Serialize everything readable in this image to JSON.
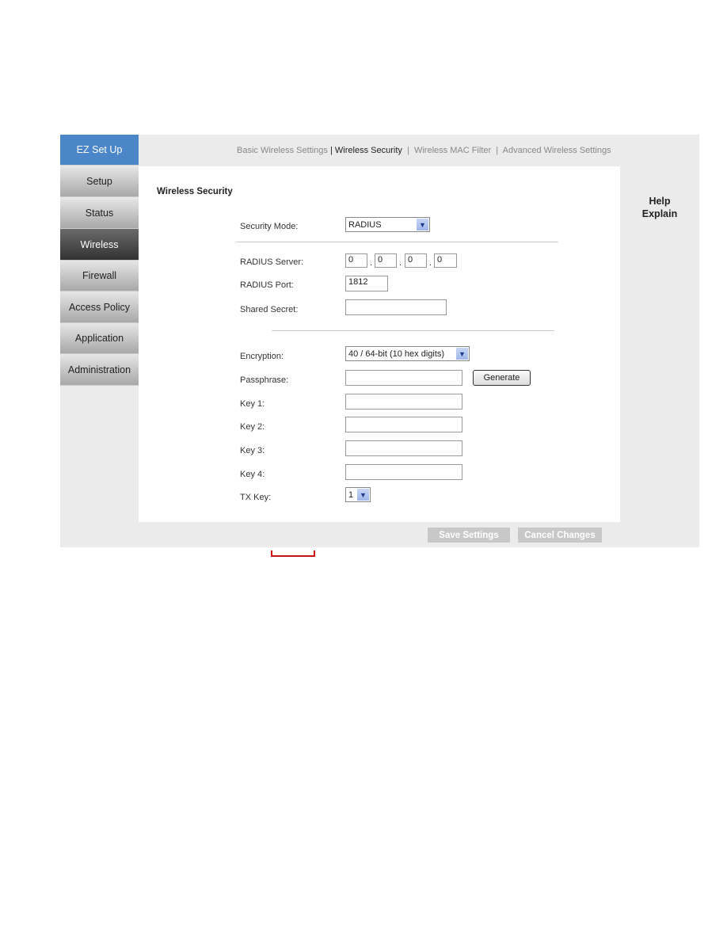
{
  "sidebar": {
    "items": [
      {
        "label": "EZ Set Up"
      },
      {
        "label": "Setup"
      },
      {
        "label": "Status"
      },
      {
        "label": "Wireless"
      },
      {
        "label": "Firewall"
      },
      {
        "label": "Access Policy"
      },
      {
        "label": "Application"
      },
      {
        "label": "Administration"
      }
    ]
  },
  "tabs": [
    {
      "label": "Basic Wireless Settings"
    },
    {
      "label": "Wireless Security"
    },
    {
      "label": "Wireless MAC Filter"
    },
    {
      "label": "Advanced Wireless Settings"
    }
  ],
  "section_title": "Wireless Security",
  "help": {
    "line1": "Help",
    "line2": "Explain"
  },
  "form": {
    "security_mode_label": "Security Mode:",
    "security_mode": "RADIUS",
    "radius_server_label": "RADIUS Server:",
    "radius_server": [
      "0",
      "0",
      "0",
      "0"
    ],
    "radius_port_label": "RADIUS Port:",
    "radius_port": "1812",
    "shared_secret_label": "Shared Secret:",
    "shared_secret": "",
    "encryption_label": "Encryption:",
    "encryption": "40 / 64-bit (10 hex digits)",
    "passphrase_label": "Passphrase:",
    "passphrase": "",
    "generate_label": "Generate",
    "key1_label": "Key 1:",
    "key2_label": "Key 2:",
    "key3_label": "Key 3:",
    "key4_label": "Key 4:",
    "txkey_label": "TX Key:",
    "txkey": "1"
  },
  "footer": {
    "save_label": "Save Settings",
    "cancel_label": "Cancel Changes"
  },
  "colors": {
    "accent": "#4a86c8",
    "active_nav": "#444444",
    "annotation": "#d01010"
  }
}
